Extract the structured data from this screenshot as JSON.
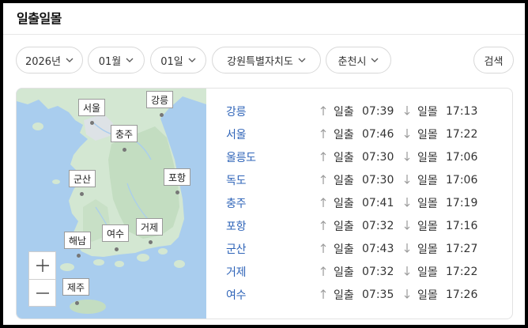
{
  "page": {
    "title": "일출일몰"
  },
  "filters": {
    "year": "2026년",
    "month": "01월",
    "day": "01일",
    "province": "강원특별자치도",
    "city": "춘천시",
    "search_label": "검색"
  },
  "map": {
    "markers": [
      {
        "name": "서울"
      },
      {
        "name": "강릉"
      },
      {
        "name": "충주"
      },
      {
        "name": "군산"
      },
      {
        "name": "포항"
      },
      {
        "name": "해남"
      },
      {
        "name": "여수"
      },
      {
        "name": "거제"
      },
      {
        "name": "제주"
      }
    ],
    "zoom_in_icon": "plus-icon",
    "zoom_out_icon": "minus-icon",
    "colors": {
      "sea": "#a9cdee",
      "land": "#d3e7d2",
      "forest": "#c3ddc1"
    }
  },
  "list": {
    "sunrise_label": "일출",
    "sunset_label": "일몰",
    "sunrise_icon": "sunrise-arrow-icon",
    "sunset_icon": "sunset-arrow-icon",
    "rows": [
      {
        "city": "강릉",
        "sunrise": "07:39",
        "sunset": "17:13"
      },
      {
        "city": "서울",
        "sunrise": "07:46",
        "sunset": "17:22"
      },
      {
        "city": "울릉도",
        "sunrise": "07:30",
        "sunset": "17:06"
      },
      {
        "city": "독도",
        "sunrise": "07:30",
        "sunset": "17:06"
      },
      {
        "city": "충주",
        "sunrise": "07:41",
        "sunset": "17:19"
      },
      {
        "city": "포항",
        "sunrise": "07:32",
        "sunset": "17:16"
      },
      {
        "city": "군산",
        "sunrise": "07:43",
        "sunset": "17:27"
      },
      {
        "city": "거제",
        "sunrise": "07:32",
        "sunset": "17:22"
      },
      {
        "city": "여수",
        "sunrise": "07:35",
        "sunset": "17:26"
      }
    ]
  }
}
